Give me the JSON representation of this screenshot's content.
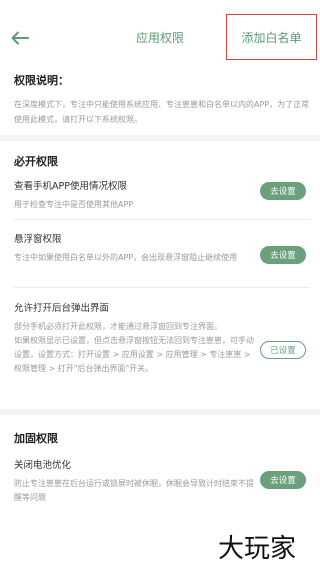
{
  "header": {
    "back_icon": "arrow-left-icon",
    "title": "应用权限",
    "whitelist_label": "添加白名单",
    "accent_color": "#5d9a72"
  },
  "intro": {
    "title": "权限说明：",
    "text": "在深度模式下，专注中只能使用系统应用、专注崽崽和白名单以内的APP，为了正常使用此模式，请打开以下系统权限。"
  },
  "required": {
    "title": "必开权限",
    "items": [
      {
        "name": "查看手机APP使用情况权限",
        "desc": "用于检查专注中是否使用其他APP",
        "button": "去设置",
        "state": "unset"
      },
      {
        "name": "悬浮窗权限",
        "desc": "专注中如果使用白名单以外的APP，会出现悬浮窗阻止继续使用",
        "button": "去设置",
        "state": "unset"
      },
      {
        "name": "允许打开后台弹出界面",
        "desc": "部分手机必须打开此权限，才能通过悬浮窗回到专注界面。",
        "desc2": "如果权限显示已设置，但点击悬浮窗按钮无法回到专注崽崽，可手动设置。设置方式：打开设置 > 应用设置 > 应用管理 > 专注崽崽 > 权限管理 > 打开\"后台弹出界面\"开关。",
        "button": "已设置",
        "state": "set"
      }
    ]
  },
  "enhance": {
    "title": "加固权限",
    "items": [
      {
        "name": "关闭电池优化",
        "desc": "防止专注崽崽在后台运行或锁屏时被休眠，休眠会导致计时结束不提醒等问题",
        "button": "去设置",
        "state": "unset"
      }
    ]
  },
  "watermark": "大玩家",
  "button_color": "#6aa07c"
}
